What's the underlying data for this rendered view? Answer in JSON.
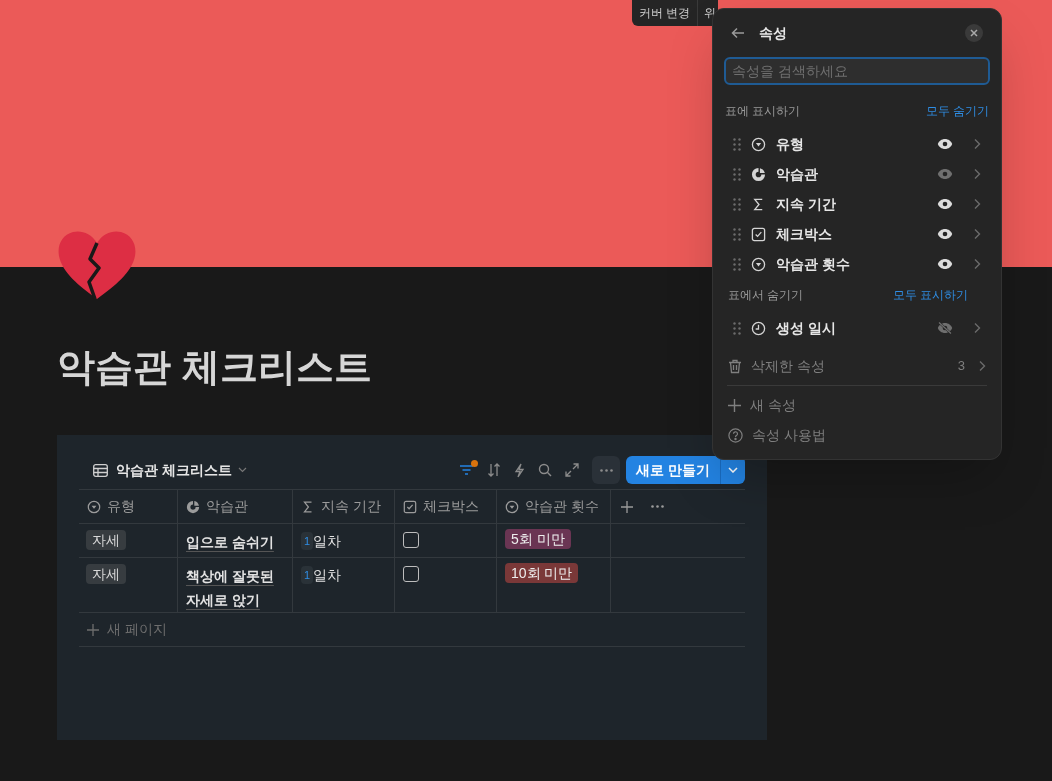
{
  "cover_controls": [
    "커버 변경",
    "위"
  ],
  "page": {
    "title": "악습관 체크리스트"
  },
  "database": {
    "view_title": "악습관 체크리스트",
    "filter_active": true,
    "new_button": "새로 만들기",
    "columns": [
      {
        "kind": "select",
        "label": "유형"
      },
      {
        "kind": "title",
        "label": "악습관"
      },
      {
        "kind": "formula",
        "label": "지속 기간"
      },
      {
        "kind": "checkbox",
        "label": "체크박스"
      },
      {
        "kind": "select",
        "label": "악습관 횟수"
      }
    ],
    "rows": [
      {
        "type": "자세",
        "habit": "입으로 숨쉬기",
        "days_badge": "1",
        "days": "일차",
        "checked": false,
        "count": {
          "label": "5회 미만",
          "color": "#6a3553"
        }
      },
      {
        "type": "자세",
        "habit": "책상에 잘못된 자세로 앉기",
        "days_badge": "1",
        "days": "일차",
        "checked": false,
        "count": {
          "label": "10회 미만",
          "color": "#7a3838"
        }
      }
    ],
    "new_page": "새 페이지"
  },
  "properties_panel": {
    "title": "속성",
    "search": {
      "placeholder": "속성을 검색하세요"
    },
    "shown_header": "표에 표시하기",
    "hide_all": "모두 숨기기",
    "shown": [
      {
        "kind": "select",
        "label": "유형",
        "visible": true,
        "toggle_disabled": false
      },
      {
        "kind": "title",
        "label": "악습관",
        "visible": true,
        "toggle_disabled": true
      },
      {
        "kind": "formula",
        "label": "지속 기간",
        "visible": true,
        "toggle_disabled": false
      },
      {
        "kind": "checkbox",
        "label": "체크박스",
        "visible": true,
        "toggle_disabled": false
      },
      {
        "kind": "select",
        "label": "악습관 횟수",
        "visible": true,
        "toggle_disabled": false
      }
    ],
    "hidden_header": "표에서 숨기기",
    "show_all": "모두 표시하기",
    "hidden": [
      {
        "kind": "time",
        "label": "생성 일시",
        "visible": false,
        "toggle_disabled": false
      }
    ],
    "deleted": {
      "label": "삭제한 속성",
      "count": "3"
    },
    "new_property": "새 속성",
    "help": "속성 사용법"
  }
}
